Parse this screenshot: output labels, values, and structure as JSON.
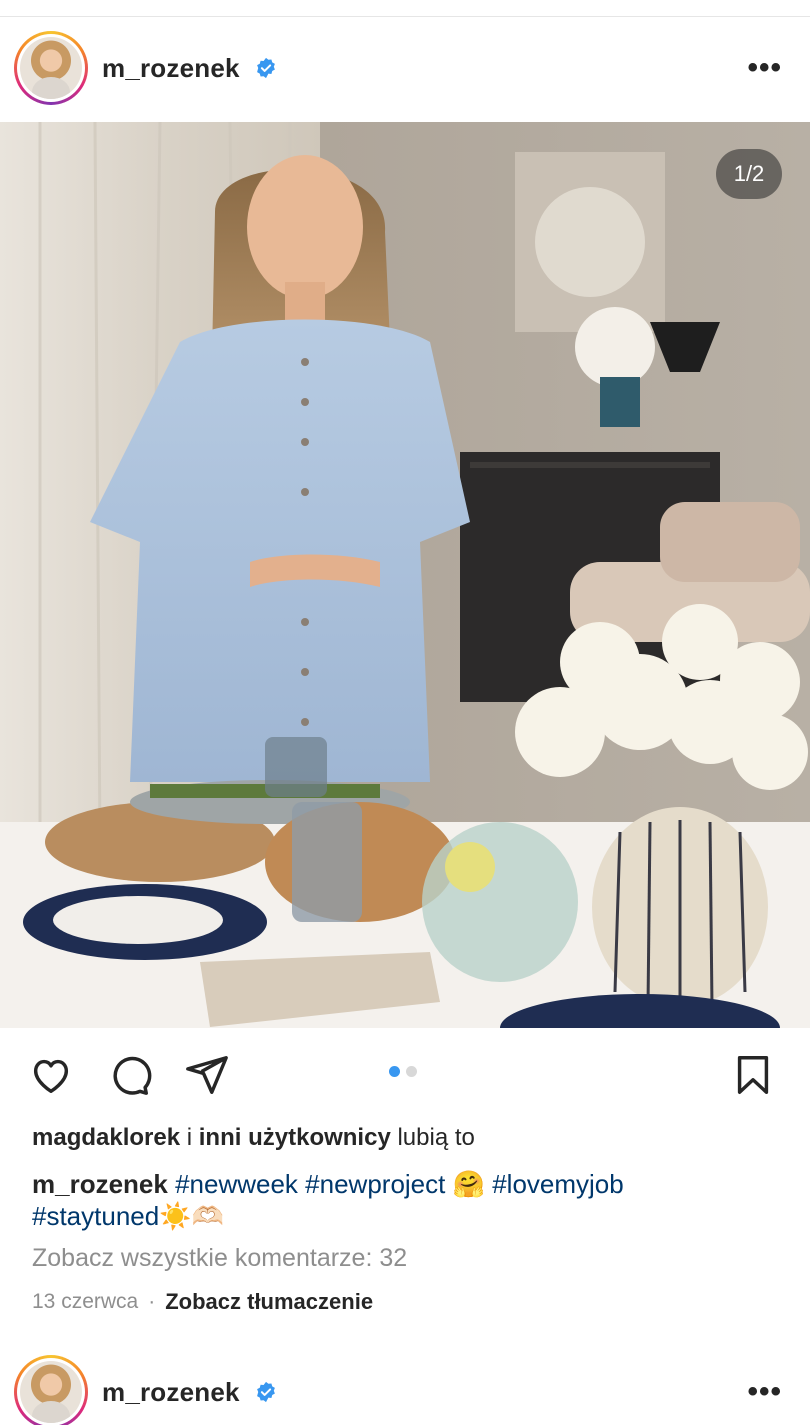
{
  "post": {
    "username": "m_rozenek",
    "verified": true,
    "more_icon": "more-horizontal-icon",
    "counter": "1/2",
    "likes": {
      "liker": "magdaklorek",
      "connector": "i",
      "others": "inni użytkownicy",
      "suffix": "lubią to"
    },
    "caption": {
      "username": "m_rozenek",
      "tags": [
        "#newweek",
        "#newproject",
        "#lovemyjob",
        "#staytuned"
      ],
      "emoji_hug": "🤗",
      "emoji_sun": "☀️",
      "emoji_hands": "🫶🏻"
    },
    "view_comments": "Zobacz wszystkie komentarze: 32",
    "date": "13 czerwca",
    "separator": "·",
    "translate": "Zobacz tłumaczenie",
    "carousel": {
      "total": 2,
      "active": 1
    }
  },
  "next_post": {
    "username": "m_rozenek",
    "verified": true
  },
  "icons": [
    "heart-icon",
    "comment-icon",
    "share-icon",
    "bookmark-icon",
    "verified-badge-icon"
  ],
  "colors": {
    "link": "#00376b",
    "verified": "#3897f0",
    "muted": "#8e8e8e",
    "carousel_active": "#3897f0"
  }
}
